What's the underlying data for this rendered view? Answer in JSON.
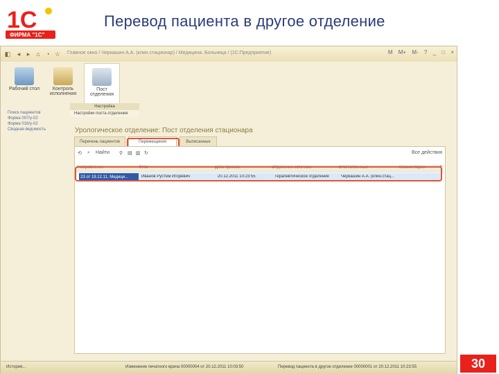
{
  "slide": {
    "title": "Перевод пациента в другое отделение",
    "logo_text": "1С",
    "logo_sub": "ФИРМА \"1С\"",
    "page_number": "30"
  },
  "window": {
    "breadcrumb": "Главное окно / Черкашин А.А. (клин.стационар) / Медицина. Больница / (1С:Предприятие)",
    "controls": [
      "M",
      "M+",
      "M-",
      "?",
      "_",
      "□",
      "×"
    ]
  },
  "ribbon": {
    "buttons": [
      {
        "label": "Рабочий стол"
      },
      {
        "label": "Контроль исполнения"
      },
      {
        "label": "Пост отделения"
      }
    ]
  },
  "leftnav": {
    "items": [
      "Поиск пациентов",
      "Форма 007/у-02",
      "Форма 016/у-02",
      "Сводная ведомость"
    ]
  },
  "subnav": {
    "header": "Настройка",
    "item": "Настройки поста отделения"
  },
  "content": {
    "heading": "Урологическое отделение: Пост отделения стационара",
    "tabs": [
      "Перечень пациентов",
      "Перемещения",
      "Выписанные"
    ],
    "toolbar": {
      "find": "Найти",
      "options": "Все действия"
    },
    "columns": [
      "Направление",
      "ФИО",
      "Дата приема",
      "Отделение источник",
      "Ответственный",
      "Комментарий"
    ],
    "row": {
      "doc": "23 от 19.12.11, Медици...",
      "name": "Иванов Рустем Игоревич",
      "date": "20.12.2011 10:23:55",
      "dept": "Терапевтическое отделение",
      "resp": "Черкашин А.А. (клин.стац...",
      "comment": ""
    }
  },
  "status": {
    "history": "История...",
    "msg1": "Изменение печатного врача 00000004 от 20.12.2011 10:03:50",
    "msg2": "Перевод пациента в другое отделение 00000001 от 20.12.2011 10:23:55"
  },
  "colors": {
    "accent": "#e0533a",
    "page_number_bg": "#e8221b",
    "title": "#2a3b7a"
  }
}
